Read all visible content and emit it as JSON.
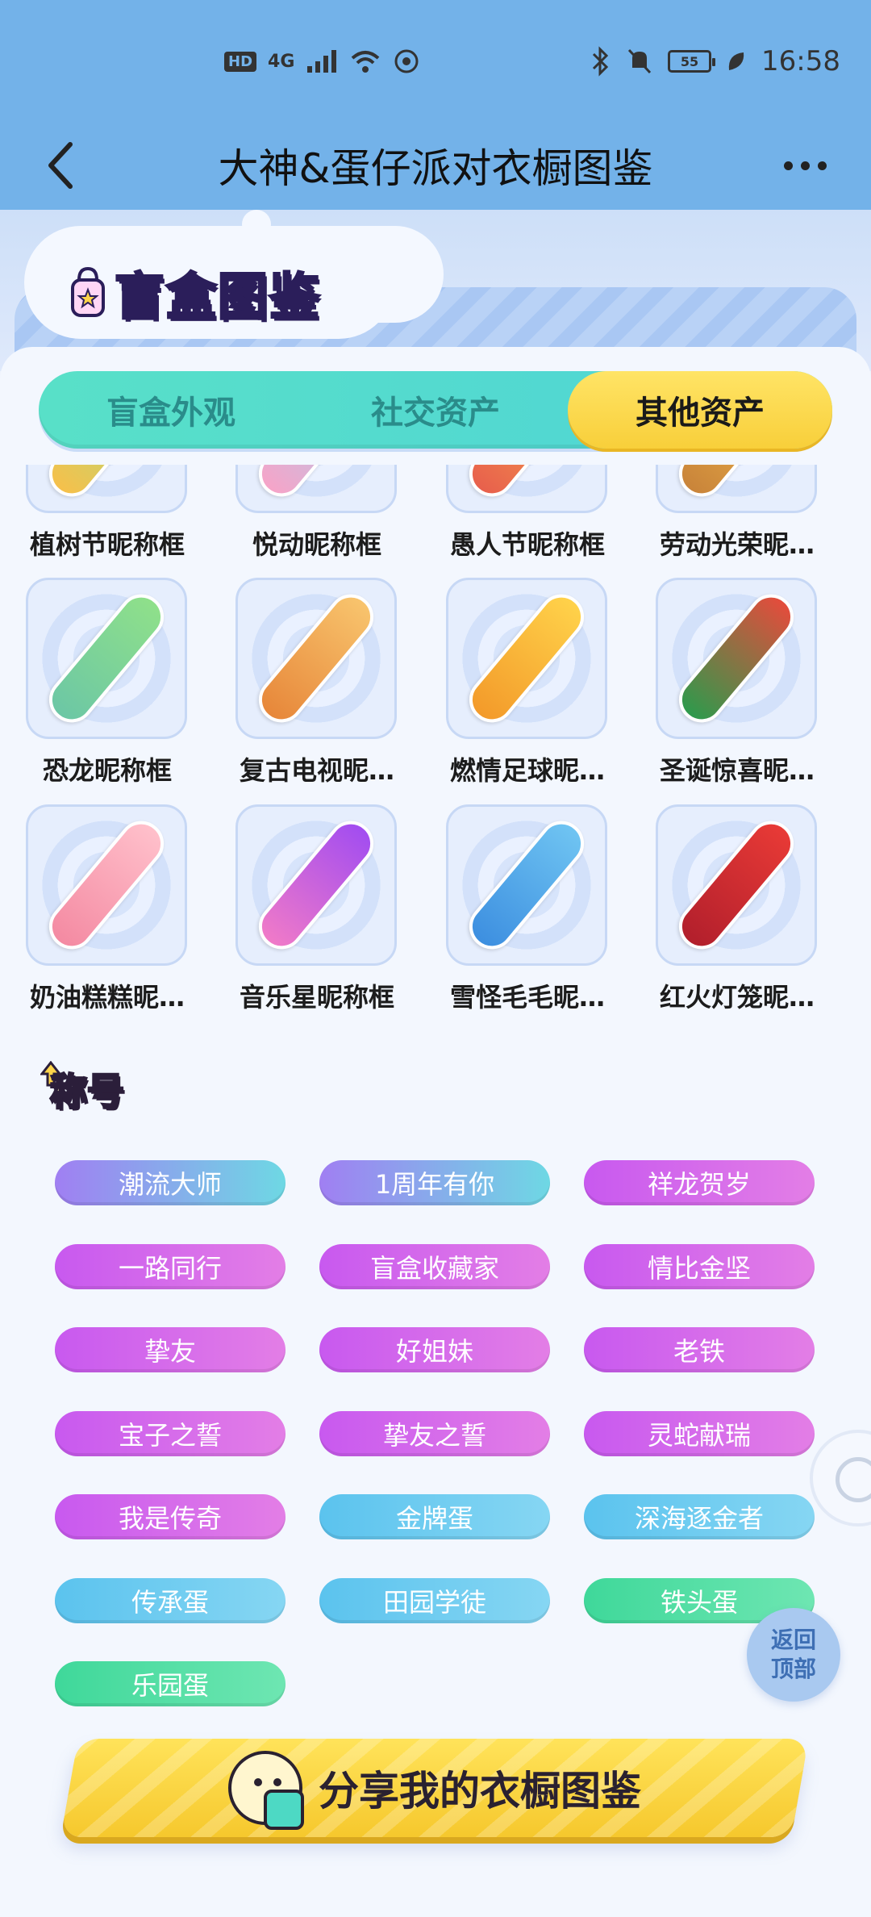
{
  "status_bar": {
    "hd": "HD",
    "network": "4G",
    "battery": "55",
    "time": "16:58"
  },
  "nav": {
    "title": "大神&蛋仔派对衣橱图鉴"
  },
  "banner": {
    "title": "盲盒图鉴"
  },
  "tabs": [
    {
      "label": "盲盒外观",
      "active": false
    },
    {
      "label": "社交资产",
      "active": false
    },
    {
      "label": "其他资产",
      "active": true
    }
  ],
  "grid_rows": [
    [
      {
        "label": "植树节昵称框",
        "colors": [
          "#9be38a",
          "#f6c04b"
        ]
      },
      {
        "label": "悦动昵称框",
        "colors": [
          "#9bd6f6",
          "#f6a4c8"
        ]
      },
      {
        "label": "愚人节昵称框",
        "colors": [
          "#f7b04a",
          "#e8604c"
        ]
      },
      {
        "label": "劳动光荣昵…",
        "colors": [
          "#f6c04b",
          "#c9843a"
        ]
      }
    ],
    [
      {
        "label": "恐龙昵称框",
        "colors": [
          "#8fe08a",
          "#6cc7a5"
        ]
      },
      {
        "label": "复古电视昵…",
        "colors": [
          "#f8c46d",
          "#e7873a"
        ]
      },
      {
        "label": "燃情足球昵…",
        "colors": [
          "#ffd24a",
          "#f39a2a"
        ]
      },
      {
        "label": "圣诞惊喜昵…",
        "colors": [
          "#e44c3c",
          "#2e9a4c"
        ]
      }
    ],
    [
      {
        "label": "奶油糕糕昵…",
        "colors": [
          "#ffc0cb",
          "#f48aa2"
        ]
      },
      {
        "label": "音乐星昵称框",
        "colors": [
          "#a24df0",
          "#f07ac8"
        ]
      },
      {
        "label": "雪怪毛毛昵…",
        "colors": [
          "#6fc4f2",
          "#3d8fe0"
        ]
      },
      {
        "label": "红火灯笼昵…",
        "colors": [
          "#e83a36",
          "#b21f2c"
        ]
      }
    ]
  ],
  "titles_section": {
    "heading": "称号",
    "items": [
      {
        "label": "潮流大师",
        "color_a": "#a07ff2",
        "color_b": "#6ed8e4"
      },
      {
        "label": "1周年有你",
        "color_a": "#a07ff2",
        "color_b": "#6ed8e4"
      },
      {
        "label": "祥龙贺岁",
        "color_a": "#c859ef",
        "color_b": "#e37ee6"
      },
      {
        "label": "一路同行",
        "color_a": "#c859ef",
        "color_b": "#e37ee6"
      },
      {
        "label": "盲盒收藏家",
        "color_a": "#c859ef",
        "color_b": "#e37ee6"
      },
      {
        "label": "情比金坚",
        "color_a": "#c859ef",
        "color_b": "#e37ee6"
      },
      {
        "label": "挚友",
        "color_a": "#c859ef",
        "color_b": "#e37ee6"
      },
      {
        "label": "好姐妹",
        "color_a": "#c859ef",
        "color_b": "#e37ee6"
      },
      {
        "label": "老铁",
        "color_a": "#c859ef",
        "color_b": "#e37ee6"
      },
      {
        "label": "宝子之誓",
        "color_a": "#c859ef",
        "color_b": "#e37ee6"
      },
      {
        "label": "挚友之誓",
        "color_a": "#c859ef",
        "color_b": "#e37ee6"
      },
      {
        "label": "灵蛇献瑞",
        "color_a": "#c859ef",
        "color_b": "#e37ee6"
      },
      {
        "label": "我是传奇",
        "color_a": "#c859ef",
        "color_b": "#e37ee6"
      },
      {
        "label": "金牌蛋",
        "color_a": "#5bc3ee",
        "color_b": "#86d6f3"
      },
      {
        "label": "深海逐金者",
        "color_a": "#5bc3ee",
        "color_b": "#86d6f3"
      },
      {
        "label": "传承蛋",
        "color_a": "#5bc3ee",
        "color_b": "#86d6f3"
      },
      {
        "label": "田园学徒",
        "color_a": "#5bc3ee",
        "color_b": "#86d6f3"
      },
      {
        "label": "铁头蛋",
        "color_a": "#3fd89a",
        "color_b": "#6ee6b2"
      },
      {
        "label": "乐园蛋",
        "color_a": "#3fd89a",
        "color_b": "#6ee6b2"
      }
    ]
  },
  "back_to_top": {
    "line1": "返回",
    "line2": "顶部"
  },
  "share_button": {
    "label": "分享我的衣橱图鉴"
  }
}
